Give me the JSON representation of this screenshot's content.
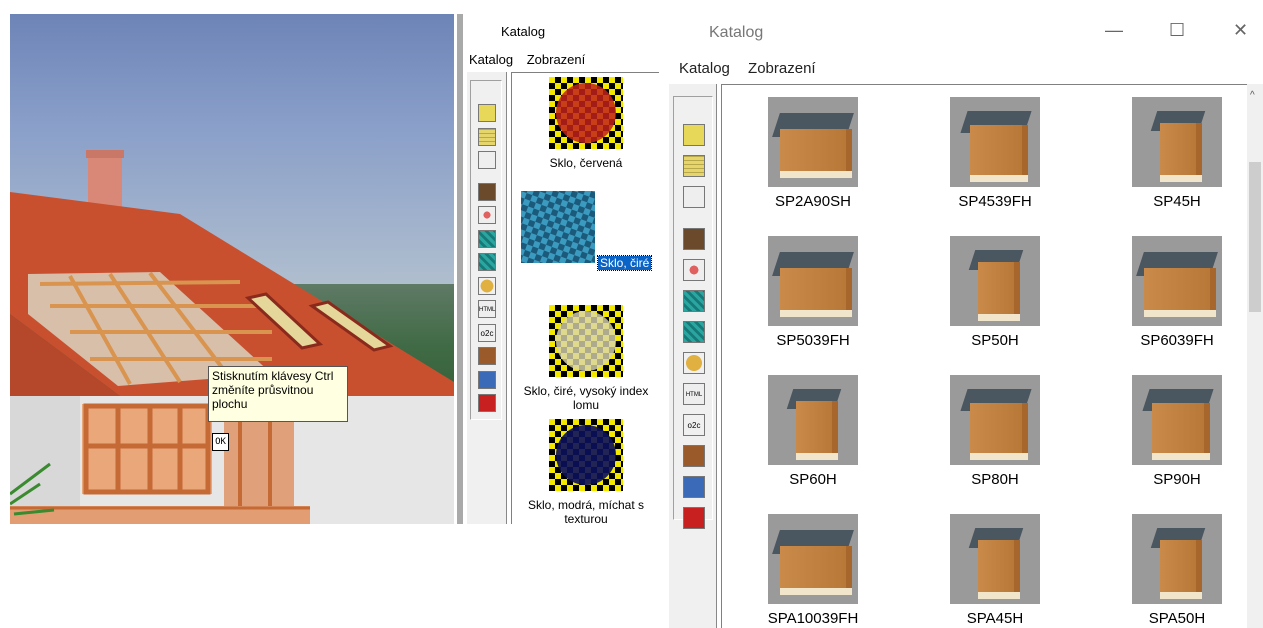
{
  "scene": {
    "tooltip": "Stisknutím klávesy Ctrl změníte průsvitnou plochu",
    "ok_label": "OK"
  },
  "small_catalog": {
    "title": "Katalog",
    "menu": [
      "Katalog",
      "Zobrazení"
    ],
    "items": [
      {
        "label": "Sklo, červená",
        "selected": false,
        "color": "#c0211b"
      },
      {
        "label": "Sklo, čiré",
        "selected": true,
        "color": "#2b7a9e"
      },
      {
        "label": "Sklo, čiré, vysoký index lomu",
        "selected": false,
        "color": "#e6e0a6"
      },
      {
        "label": "Sklo, modrá, míchat s texturou",
        "selected": false,
        "color": "#0b0f5c"
      }
    ]
  },
  "catalog_window": {
    "title": "Katalog",
    "controls": {
      "minimize": "—",
      "maximize": "☐",
      "close": "✕"
    },
    "menu": [
      "Katalog",
      "Zobrazení"
    ],
    "items": [
      {
        "label": "SP2A90SH",
        "shape": "wide"
      },
      {
        "label": "SP4539FH",
        "shape": "mid"
      },
      {
        "label": "SP45H",
        "shape": "narrow"
      },
      {
        "label": "SP5039FH",
        "shape": "wide"
      },
      {
        "label": "SP50H",
        "shape": "narrow"
      },
      {
        "label": "SP6039FH",
        "shape": "wide"
      },
      {
        "label": "SP60H",
        "shape": "narrow"
      },
      {
        "label": "SP80H",
        "shape": "mid"
      },
      {
        "label": "SP90H",
        "shape": "mid"
      },
      {
        "label": "SPA10039FH",
        "shape": "wide"
      },
      {
        "label": "SPA45H",
        "shape": "narrow"
      },
      {
        "label": "SPA50H",
        "shape": "narrow"
      }
    ]
  },
  "toolbar_icons": [
    "folder-icon",
    "grid-icon",
    "filter-icon",
    "chair-icon",
    "target-icon",
    "texture-icon",
    "texture-folder-icon",
    "sphere-icon",
    "html-icon",
    "o2c-icon",
    "door-icon",
    "window-icon",
    "red-door-icon"
  ]
}
